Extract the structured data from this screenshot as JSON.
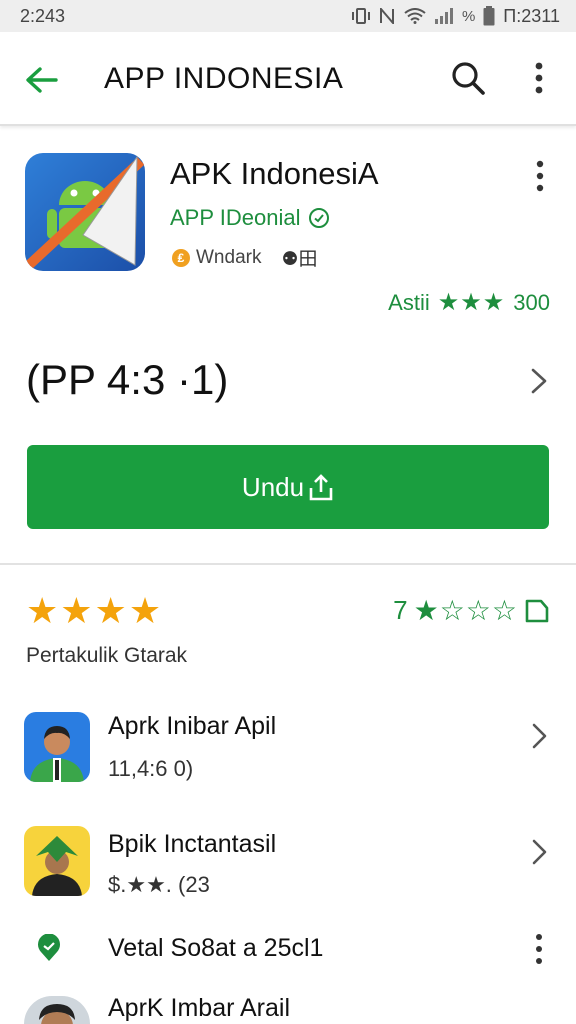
{
  "status": {
    "time_left": "2:243",
    "time_right": "Π:2311",
    "battery_label": "%"
  },
  "appbar": {
    "title": "APP INDONESIA"
  },
  "app": {
    "name": "APK IndonesiA",
    "developer": "APP IDeonial",
    "meta": "Wndark",
    "meta_extra": "⚉田",
    "rating_label": "Astii",
    "rating_stars": "★★★",
    "rating_count": "300",
    "version": "(PP 4:3 ·1)",
    "install_label": "Undu"
  },
  "reviews": {
    "stars": "★★★★",
    "summary_number": "7",
    "summary_stars": "★☆☆☆",
    "section_label": "Pertakulik Gtarak"
  },
  "list": [
    {
      "title": "Aprk Inibar Apil",
      "subtitle": "11,4:6 0)"
    },
    {
      "title": "Bpik Inctantasil",
      "subtitle": "$.★★. (23"
    },
    {
      "title": "Vetal So8at a 25cl1"
    },
    {
      "title": "AprK Imbar Arail"
    }
  ],
  "colors": {
    "accent": "#1a9e3f",
    "star_orange": "#f4a30c",
    "text_green": "#1e8e3e"
  }
}
